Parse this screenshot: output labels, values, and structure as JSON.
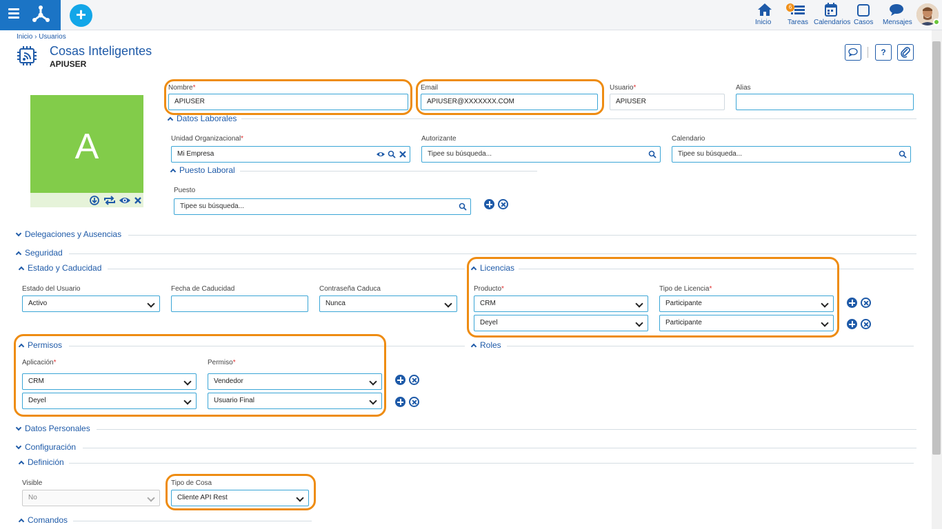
{
  "topbar": {
    "nav": [
      {
        "label": "Inicio",
        "icon": "home-icon"
      },
      {
        "label": "Tareas",
        "icon": "tasks-icon",
        "badge": "6"
      },
      {
        "label": "Calendarios",
        "icon": "calendar-icon"
      },
      {
        "label": "Casos",
        "icon": "cases-icon"
      },
      {
        "label": "Mensajes",
        "icon": "messages-icon"
      }
    ],
    "accent": "#1b74c5",
    "add_button": "+"
  },
  "breadcrumb": "Inicio › Usuarios",
  "header": {
    "title": "Cosas Inteligentes",
    "subtitle": "APIUSER",
    "help": "?"
  },
  "photo": {
    "initial": "A"
  },
  "fields": {
    "nombre": {
      "label": "Nombre",
      "value": "APIUSER"
    },
    "email": {
      "label": "Email",
      "value": "APIUSER@XXXXXXX.COM"
    },
    "usuario": {
      "label": "Usuario",
      "value": "APIUSER"
    },
    "alias": {
      "label": "Alias",
      "value": ""
    }
  },
  "sections": {
    "datos_laborales": "Datos Laborales",
    "puesto_laboral": "Puesto Laboral",
    "delegaciones": "Delegaciones y Ausencias",
    "seguridad": "Seguridad",
    "estado": "Estado y Caducidad",
    "licencias": "Licencias",
    "permisos": "Permisos",
    "roles": "Roles",
    "datos_personales": "Datos Personales",
    "configuracion": "Configuración",
    "definicion": "Definición",
    "comandos": "Comandos"
  },
  "laborales": {
    "unidad": {
      "label": "Unidad Organizacional",
      "value": "Mi Empresa"
    },
    "autorizante": {
      "label": "Autorizante",
      "placeholder": "Tipee su búsqueda..."
    },
    "calendario": {
      "label": "Calendario",
      "placeholder": "Tipee su búsqueda..."
    },
    "puesto": {
      "label": "Puesto",
      "placeholder": "Tipee su búsqueda..."
    }
  },
  "estado": {
    "estado_usuario": {
      "label": "Estado del Usuario",
      "value": "Activo"
    },
    "fecha_caducidad": {
      "label": "Fecha de Caducidad",
      "value": ""
    },
    "contrasena": {
      "label": "Contraseña Caduca",
      "value": "Nunca"
    }
  },
  "licencias": {
    "producto_label": "Producto",
    "tipo_label": "Tipo de Licencia",
    "rows": [
      {
        "producto": "CRM",
        "tipo": "Participante"
      },
      {
        "producto": "Deyel",
        "tipo": "Participante"
      }
    ]
  },
  "permisos": {
    "aplicacion_label": "Aplicación",
    "permiso_label": "Permiso",
    "rows": [
      {
        "aplicacion": "CRM",
        "permiso": "Vendedor"
      },
      {
        "aplicacion": "Deyel",
        "permiso": "Usuario Final"
      }
    ]
  },
  "definicion": {
    "visible": {
      "label": "Visible",
      "value": "No"
    },
    "tipo_cosa": {
      "label": "Tipo de Cosa",
      "value": "Cliente API Rest"
    }
  },
  "colors": {
    "highlight": "#ee8c12",
    "link": "#1e5aa8",
    "photo": "#82cc4a"
  }
}
